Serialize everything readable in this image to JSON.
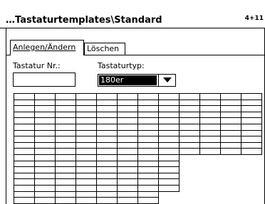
{
  "window": {
    "title": "…Tastaturtemplates\\Standard",
    "page_indicator": "4+11"
  },
  "tabs": [
    {
      "label": "Anlegen/Ändern",
      "active": true
    },
    {
      "label": "Löschen",
      "active": false
    }
  ],
  "form": {
    "keyboard_no_label": "Tastatur Nr.:",
    "keyboard_no_value": "",
    "keyboard_type_label": "Tastaturtyp:",
    "keyboard_type_value": "180er"
  },
  "grid": {
    "rows_full": 10,
    "rows_total": 18,
    "cols_full": 12,
    "cols_lower": 8,
    "cols_bottom": 7
  }
}
